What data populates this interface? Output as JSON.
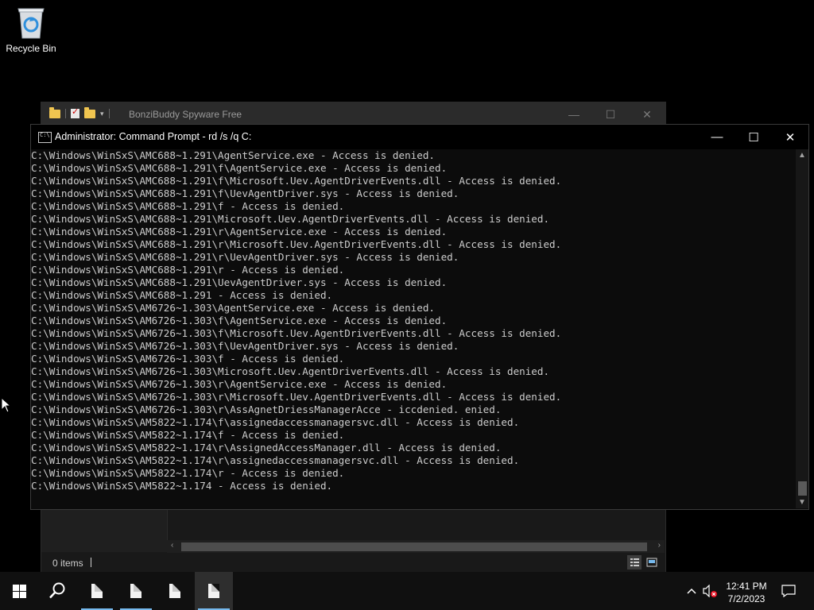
{
  "desktop": {
    "recycle_bin_label": "Recycle Bin"
  },
  "explorer": {
    "title": "BonziBuddy Spyware Free",
    "status_items": "0 items",
    "minimize": "—",
    "maximize": "☐",
    "close": "✕"
  },
  "console": {
    "title": "Administrator:  Command Prompt - rd  /s /q C:",
    "minimize": "—",
    "maximize": "☐",
    "close": "✕",
    "lines": [
      "C:\\Windows\\WinSxS\\AMC688~1.291\\AgentService.exe - Access is denied.",
      "C:\\Windows\\WinSxS\\AMC688~1.291\\f\\AgentService.exe - Access is denied.",
      "C:\\Windows\\WinSxS\\AMC688~1.291\\f\\Microsoft.Uev.AgentDriverEvents.dll - Access is denied.",
      "C:\\Windows\\WinSxS\\AMC688~1.291\\f\\UevAgentDriver.sys - Access is denied.",
      "C:\\Windows\\WinSxS\\AMC688~1.291\\f - Access is denied.",
      "C:\\Windows\\WinSxS\\AMC688~1.291\\Microsoft.Uev.AgentDriverEvents.dll - Access is denied.",
      "C:\\Windows\\WinSxS\\AMC688~1.291\\r\\AgentService.exe - Access is denied.",
      "C:\\Windows\\WinSxS\\AMC688~1.291\\r\\Microsoft.Uev.AgentDriverEvents.dll - Access is denied.",
      "C:\\Windows\\WinSxS\\AMC688~1.291\\r\\UevAgentDriver.sys - Access is denied.",
      "C:\\Windows\\WinSxS\\AMC688~1.291\\r - Access is denied.",
      "C:\\Windows\\WinSxS\\AMC688~1.291\\UevAgentDriver.sys - Access is denied.",
      "C:\\Windows\\WinSxS\\AMC688~1.291 - Access is denied.",
      "C:\\Windows\\WinSxS\\AM6726~1.303\\AgentService.exe - Access is denied.",
      "C:\\Windows\\WinSxS\\AM6726~1.303\\f\\AgentService.exe - Access is denied.",
      "C:\\Windows\\WinSxS\\AM6726~1.303\\f\\Microsoft.Uev.AgentDriverEvents.dll - Access is denied.",
      "C:\\Windows\\WinSxS\\AM6726~1.303\\f\\UevAgentDriver.sys - Access is denied.",
      "C:\\Windows\\WinSxS\\AM6726~1.303\\f - Access is denied.",
      "C:\\Windows\\WinSxS\\AM6726~1.303\\Microsoft.Uev.AgentDriverEvents.dll - Access is denied.",
      "C:\\Windows\\WinSxS\\AM6726~1.303\\r\\AgentService.exe - Access is denied.",
      "C:\\Windows\\WinSxS\\AM6726~1.303\\r\\Microsoft.Uev.AgentDriverEvents.dll - Access is denied.",
      "C:\\Windows\\WinSxS\\AM6726~1.303\\r\\AssAgnetDriessManagerAcce - iccdenied. enied.",
      "C:\\Windows\\WinSxS\\AM5822~1.174\\f\\assignedaccessmanagersvc.dll - Access is denied.",
      "C:\\Windows\\WinSxS\\AM5822~1.174\\f - Access is denied.",
      "C:\\Windows\\WinSxS\\AM5822~1.174\\r\\AssignedAccessManager.dll - Access is denied.",
      "C:\\Windows\\WinSxS\\AM5822~1.174\\r\\assignedaccessmanagersvc.dll - Access is denied.",
      "C:\\Windows\\WinSxS\\AM5822~1.174\\r - Access is denied.",
      "C:\\Windows\\WinSxS\\AM5822~1.174 - Access is denied."
    ]
  },
  "taskbar": {
    "time": "12:41 PM",
    "date": "7/2/2023",
    "icons": [
      "windows-start-icon",
      "search-icon",
      "document-icon",
      "document-icon",
      "document-icon",
      "document-icon",
      "chevron-up-icon",
      "speaker-muted-icon",
      "notification-icon"
    ]
  },
  "colors": {
    "console_text": "#cccccc",
    "console_bg": "#0c0c0c",
    "taskbar_bg": "#101010",
    "accent": "#76b9ed"
  }
}
